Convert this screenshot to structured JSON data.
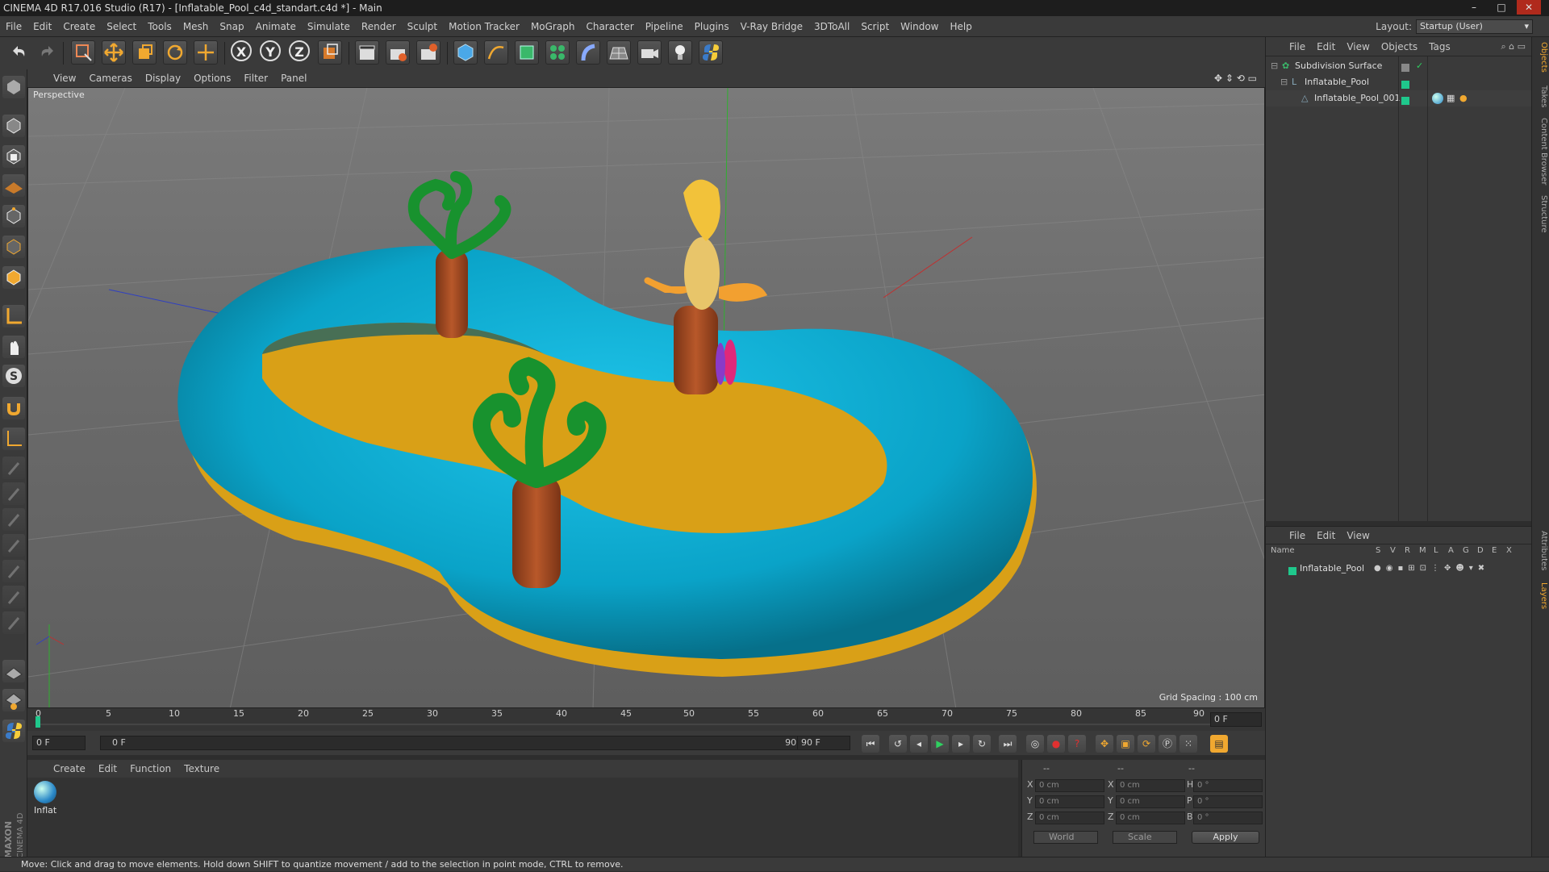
{
  "window": {
    "title": "CINEMA 4D R17.016 Studio (R17) - [Inflatable_Pool_c4d_standart.c4d *] - Main",
    "buttons": [
      "–",
      "□",
      "✕"
    ]
  },
  "menu": [
    "File",
    "Edit",
    "Create",
    "Select",
    "Tools",
    "Mesh",
    "Snap",
    "Animate",
    "Simulate",
    "Render",
    "Sculpt",
    "Motion Tracker",
    "MoGraph",
    "Character",
    "Pipeline",
    "Plugins",
    "V-Ray Bridge",
    "3DToAll",
    "Script",
    "Window",
    "Help"
  ],
  "layout": {
    "label": "Layout:",
    "value": "Startup (User)"
  },
  "toolbar": {
    "axes": [
      "X",
      "Y",
      "Z"
    ]
  },
  "viewport": {
    "menu": [
      "View",
      "Cameras",
      "Display",
      "Options",
      "Filter",
      "Panel"
    ],
    "label": "Perspective",
    "grid_spacing": "Grid Spacing : 100 cm"
  },
  "timeline": {
    "ticks": [
      "0",
      "5",
      "10",
      "15",
      "20",
      "25",
      "30",
      "35",
      "40",
      "45",
      "50",
      "55",
      "60",
      "65",
      "70",
      "75",
      "80",
      "85",
      "90"
    ],
    "current_frame": "0 F",
    "start_field": "0 F",
    "range_start": "0 F",
    "range_end": "90 F",
    "end_field": "90 F"
  },
  "material": {
    "menu": [
      "Create",
      "Edit",
      "Function",
      "Texture"
    ],
    "items": [
      {
        "name": "Inflat"
      }
    ]
  },
  "coords": {
    "header": [
      "--",
      "--",
      "--"
    ],
    "rows": [
      {
        "a": "X",
        "av": "0 cm",
        "b": "X",
        "bv": "0 cm",
        "c": "H",
        "cv": "0 °"
      },
      {
        "a": "Y",
        "av": "0 cm",
        "b": "Y",
        "bv": "0 cm",
        "c": "P",
        "cv": "0 °"
      },
      {
        "a": "Z",
        "av": "0 cm",
        "b": "Z",
        "bv": "0 cm",
        "c": "B",
        "cv": "0 °"
      }
    ],
    "world": "World",
    "scale": "Scale",
    "apply": "Apply"
  },
  "objects": {
    "menu": [
      "File",
      "Edit",
      "View",
      "Objects",
      "Tags"
    ],
    "tree": [
      {
        "name": "Subdivision Surface",
        "depth": 0
      },
      {
        "name": "Inflatable_Pool",
        "depth": 1
      },
      {
        "name": "Inflatable_Pool_001",
        "depth": 2
      }
    ]
  },
  "layers": {
    "menu": [
      "File",
      "Edit",
      "View"
    ],
    "columns": [
      "Name",
      "S",
      "V",
      "R",
      "M",
      "L",
      "A",
      "G",
      "D",
      "E",
      "X"
    ],
    "rows": [
      {
        "name": "Inflatable_Pool",
        "color": "#1fc88c"
      }
    ]
  },
  "side_tabs": [
    "Objects",
    "Takes",
    "Content Browser",
    "Structure",
    "Attributes",
    "Layers"
  ],
  "brand": {
    "maxon": "MAXON",
    "c4d": "CINEMA 4D"
  },
  "status": "Move: Click and drag to move elements. Hold down SHIFT to quantize movement / add to the selection in point mode, CTRL to remove.",
  "colors": {
    "pool_blue": "#0aa8cc",
    "pool_floor": "#d9a017",
    "palm_green": "#18922e",
    "trunk": "#a64a22",
    "layer_green": "#1fc88c"
  }
}
